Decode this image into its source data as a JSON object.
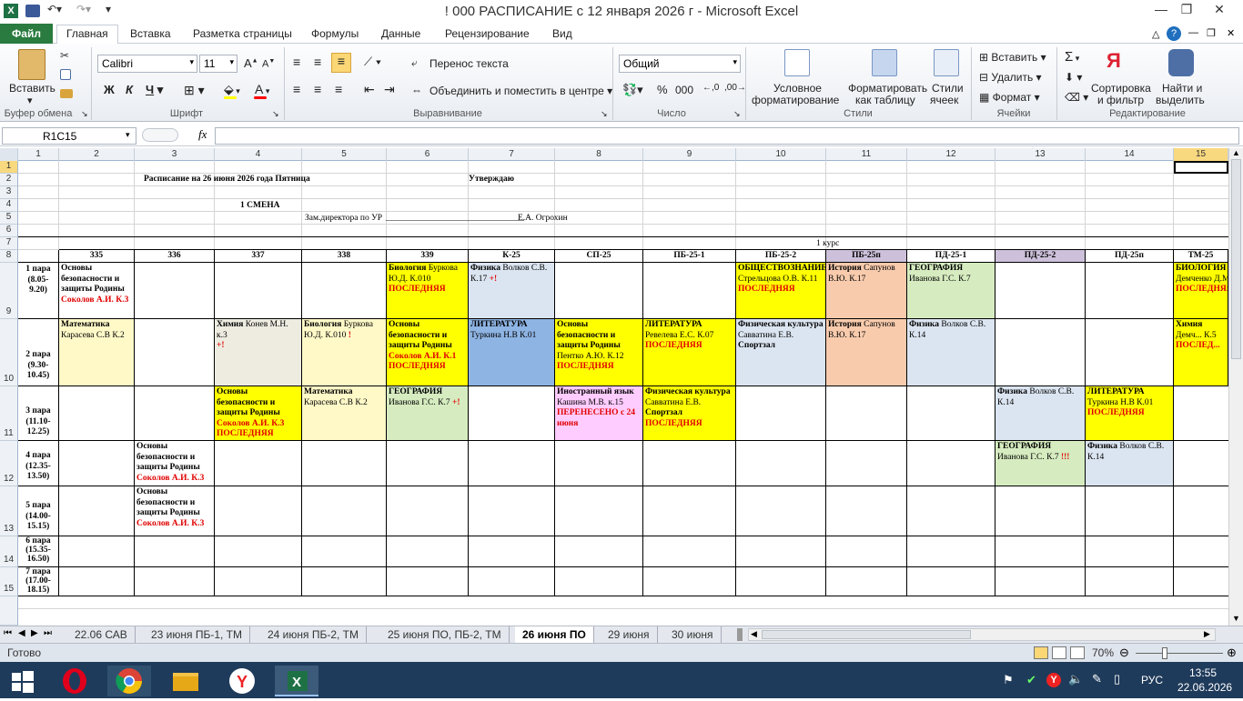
{
  "window": {
    "title": "! 000 РАСПИСАНИЕ с 12 января 2026 г  -  Microsoft Excel",
    "ribbon_tabs": [
      "Файл",
      "Главная",
      "Вставка",
      "Разметка страницы",
      "Формулы",
      "Данные",
      "Рецензирование",
      "Вид"
    ]
  },
  "ribbon": {
    "paste": "Вставить",
    "clipboard_group": "Буфер обмена",
    "font_name": "Calibri",
    "font_size": "11",
    "bold": "Ж",
    "italic": "К",
    "underline": "Ч",
    "font_group": "Шрифт",
    "wrap_text": "Перенос текста",
    "merge_center": "Объединить и поместить в центре",
    "align_group": "Выравнивание",
    "number_format": "Общий",
    "number_group": "Число",
    "percent": "%",
    "thousands": "000",
    "cond_format_1": "Условное",
    "cond_format_2": "форматирование",
    "format_table_1": "Форматировать",
    "format_table_2": "как таблицу",
    "cell_styles_1": "Стили",
    "cell_styles_2": "ячеек",
    "styles_group": "Стили",
    "insert": "Вставить",
    "delete": "Удалить",
    "format": "Формат",
    "cells_group": "Ячейки",
    "sort_1": "Сортировка",
    "sort_2": "и фильтр",
    "find_1": "Найти и",
    "find_2": "выделить",
    "edit_group": "Редактирование",
    "sum": "Σ"
  },
  "formula_bar": {
    "name_box": "R1C15",
    "fx": "fx",
    "content": ""
  },
  "columns": [
    "1",
    "2",
    "3",
    "4",
    "5",
    "6",
    "7",
    "8",
    "9",
    "10",
    "11",
    "12",
    "13",
    "14",
    "15"
  ],
  "rows": [
    "1",
    "2",
    "3",
    "4",
    "5",
    "6",
    "7",
    "8",
    "9",
    "10",
    "11",
    "12",
    "13",
    "14",
    "15"
  ],
  "header": {
    "title": "Расписание на 26 июня 2026 года  Пятница",
    "approve": "Утверждаю",
    "shift": "1 СМЕНА",
    "deputy": "Зам.директора по УР",
    "signature_line": "________________________________",
    "director": "Е.А. Огрохин",
    "course": "1 курс"
  },
  "groups": [
    "335",
    "336",
    "337",
    "338",
    "339",
    "К-25",
    "СП-25",
    "ПБ-25-1",
    "ПБ-25-2",
    "ПБ-25п",
    "ПД-25-1",
    "ПД-25-2",
    "ПД-25п",
    "ТМ-25"
  ],
  "periods": [
    [
      "1 пара",
      "(8.05-",
      "9.20)"
    ],
    [
      "2 пара",
      "(9.30-",
      "10.45)"
    ],
    [
      "3 пара",
      "(11.10-",
      "12.25)"
    ],
    [
      "4 пара",
      "(12.35-",
      "13.50)"
    ],
    [
      "5 пара",
      "(14.00-",
      "15.15)"
    ],
    [
      "6 пара",
      "(15.35-",
      "16.50)"
    ],
    [
      "7 пара",
      "(17.00-",
      "18.15)"
    ]
  ],
  "lessons": {
    "p1_c2": {
      "subj": "Основы безопасности и защиты Родины",
      "teacher": "Соколов А.И. К.3"
    },
    "p1_c6": {
      "subj": "Биология",
      "teacher": "Буркова Ю.Д. К.010",
      "note": "ПОСЛЕДНЯЯ"
    },
    "p1_c7": {
      "subj": "Физика",
      "teacher": "Волков С.В. К.17",
      "note": "+!"
    },
    "p1_c10": {
      "subj": "ОБЩЕСТВОЗНАНИЕ",
      "teacher": "Стрельцова О.В. К.11",
      "note": "ПОСЛЕДНЯЯ"
    },
    "p1_c11": {
      "subj": "История",
      "teacher": "Сапунов В.Ю. К.17"
    },
    "p1_c12": {
      "subj": "ГЕОГРАФИЯ",
      "teacher": "Иванова Г.С. К.7"
    },
    "p1_c15": {
      "subj": "БИОЛОГИЯ",
      "teacher": "Демченко Д.М.",
      "note": "ПОСЛЕДНЯЯ"
    },
    "p2_c2": {
      "subj": "Математика",
      "teacher": "Карасева С.В К.2"
    },
    "p2_c4": {
      "subj": "Химия",
      "teacher": "Конев М.Н. к.3",
      "note": "+!"
    },
    "p2_c5": {
      "subj": "Биология",
      "teacher": "Буркова Ю.Д. К.010",
      "note": "!"
    },
    "p2_c6": {
      "subj": "Основы безопасности и защиты Родины",
      "teacher": "Соколов А.И. К.1",
      "note": "ПОСЛЕДНЯЯ"
    },
    "p2_c7": {
      "subj": "ЛИТЕРАТУРА",
      "teacher": "Туркина Н.В К.01"
    },
    "p2_c8": {
      "subj": "Основы безопасности и защиты Родины",
      "teacher": "Пентко А.Ю. К.12",
      "note": "ПОСЛЕДНЯЯ"
    },
    "p2_c9": {
      "subj": "ЛИТЕРАТУРА",
      "teacher": "Ревелева Е.С. К.07",
      "note": "ПОСЛЕДНЯЯ"
    },
    "p2_c10": {
      "subj": "Физическая культура",
      "teacher": "Савватина Е.В.",
      "room": "Спортзал"
    },
    "p2_c11": {
      "subj": "История",
      "teacher": "Сапунов В.Ю. К.17"
    },
    "p2_c12": {
      "subj": "Физика",
      "teacher": "Волков С.В. К.14"
    },
    "p2_c15": {
      "subj": "Химия",
      "teacher": "Демч... К.5",
      "note": "ПОСЛЕД..."
    },
    "p3_c4": {
      "subj": "Основы безопасности и защиты Родины",
      "teacher": "Соколов А.И. К.3",
      "note": "ПОСЛЕДНЯЯ"
    },
    "p3_c5": {
      "subj": "Математика",
      "teacher": "Карасева С.В К.2"
    },
    "p3_c6": {
      "subj": "ГЕОГРАФИЯ",
      "teacher": "Иванова Г.С. К.7",
      "note": "+!"
    },
    "p3_c8": {
      "subj": "Иностранный язык",
      "teacher": "Кашина М.В. к.15",
      "note": "ПЕРЕНЕСЕНО с 24 июня"
    },
    "p3_c9": {
      "subj": "Физическая культура",
      "teacher": "Савватина Е.В.",
      "room": "Спортзал",
      "note": "ПОСЛЕДНЯЯ"
    },
    "p3_c13": {
      "subj": "Физика",
      "teacher": "Волков С.В. К.14"
    },
    "p3_c14": {
      "subj": "ЛИТЕРАТУРА",
      "teacher": "Туркина Н.В К.01",
      "note": "ПОСЛЕДНЯЯ"
    },
    "p4_c3": {
      "subj": "Основы безопасности и защиты Родины",
      "teacher": "Соколов А.И. К.3"
    },
    "p4_c13": {
      "subj": "ГЕОГРАФИЯ",
      "teacher": "Иванова Г.С. К.7",
      "note": "!!!"
    },
    "p4_c14": {
      "subj": "Физика",
      "teacher": "Волков С.В. К.14"
    },
    "p5_c3": {
      "subj": "Основы безопасности и защиты Родины",
      "teacher": "Соколов А.И. К.3"
    }
  },
  "sheet_tabs": [
    "22.06 САВ",
    "23 июня ПБ-1, ТМ",
    "24 июня ПБ-2, ТМ",
    "25 июня ПО, ПБ-2, ТМ",
    "26 июня ПО",
    "29 июня",
    "30 июня"
  ],
  "active_sheet": "26 июня ПО",
  "status": {
    "ready": "Готово",
    "zoom": "70%"
  },
  "taskbar": {
    "lang": "РУС",
    "time": "13:55",
    "date": "22.06.2026"
  },
  "colors": {
    "yellow": "#ffff00",
    "lightyellow": "#fff9c8",
    "lightgreen": "#d6ecc0",
    "lightblue": "#dbe5f1",
    "blue": "#8eb4e3",
    "peach": "#f8cbad",
    "pink": "#ffccff",
    "gray": "#eeece1",
    "lavender": "#ccc0da"
  }
}
